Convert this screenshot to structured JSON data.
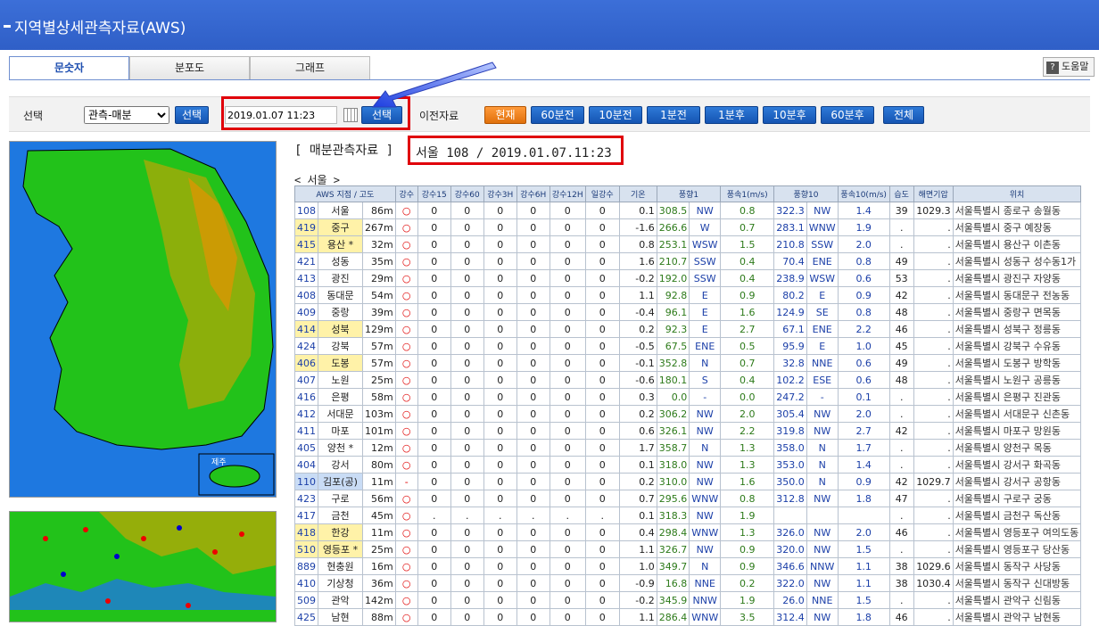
{
  "window": {
    "title": "지역별상세관측자료(AWS)"
  },
  "tabs": [
    {
      "label": "문숫자",
      "active": true
    },
    {
      "label": "분포도",
      "active": false
    },
    {
      "label": "그래프",
      "active": false
    }
  ],
  "help": {
    "label": "도움말"
  },
  "toolbar": {
    "select_label": "선택",
    "mode_value": "관측-매분",
    "select_button": "선택",
    "datetime_value": "2019.01.07 11:23",
    "confirm_button": "선택",
    "prev_label": "이전자료",
    "time_buttons": [
      "현재",
      "60분전",
      "10분전",
      "1분전",
      "1분후",
      "10분후",
      "60분후",
      "전체"
    ]
  },
  "report": {
    "header": "[ 매분관측자료 ]",
    "station_time": "서울 108 / 2019.01.07.11:23",
    "region_label": "< 서울 >"
  },
  "map": {
    "jeju_label": "제주"
  },
  "table": {
    "columns": [
      "AWS 지점 / 고도",
      "강수",
      "강수15",
      "강수60",
      "강수3H",
      "강수6H",
      "강수12H",
      "일강수",
      "기온",
      "풍향1",
      "",
      "풍속1(m/s)",
      "풍향10",
      "",
      "풍속10(m/s)",
      "습도",
      "해면기압",
      "위치"
    ],
    "rows": [
      {
        "id": "108",
        "name": "서울",
        "alt": "86m",
        "rain": "○",
        "r15": "0",
        "r60": "0",
        "r3h": "0",
        "r6h": "0",
        "r12h": "0",
        "day": "0",
        "temp": "0.1",
        "wd1": "308.5",
        "wd1n": "NW",
        "ws1": "0.8",
        "wd10": "322.3",
        "wd10n": "NW",
        "ws10": "1.4",
        "hum": "39",
        "pres": "1029.3",
        "loc": "서울특별시 종로구 송월동",
        "hl": "none"
      },
      {
        "id": "419",
        "name": "중구",
        "alt": "267m",
        "rain": "○",
        "r15": "0",
        "r60": "0",
        "r3h": "0",
        "r6h": "0",
        "r12h": "0",
        "day": "0",
        "temp": "-1.6",
        "wd1": "266.6",
        "wd1n": "W",
        "ws1": "0.7",
        "wd10": "283.1",
        "wd10n": "WNW",
        "ws10": "1.9",
        "hum": ".",
        "pres": ".",
        "loc": "서울특별시 중구 예장동",
        "hl": "yellow"
      },
      {
        "id": "415",
        "name": "용산 *",
        "alt": "32m",
        "rain": "○",
        "r15": "0",
        "r60": "0",
        "r3h": "0",
        "r6h": "0",
        "r12h": "0",
        "day": "0",
        "temp": "0.8",
        "wd1": "253.1",
        "wd1n": "WSW",
        "ws1": "1.5",
        "wd10": "210.8",
        "wd10n": "SSW",
        "ws10": "2.0",
        "hum": ".",
        "pres": ".",
        "loc": "서울특별시 용산구 이촌동",
        "hl": "yellow"
      },
      {
        "id": "421",
        "name": "성동",
        "alt": "35m",
        "rain": "○",
        "r15": "0",
        "r60": "0",
        "r3h": "0",
        "r6h": "0",
        "r12h": "0",
        "day": "0",
        "temp": "1.6",
        "wd1": "210.7",
        "wd1n": "SSW",
        "ws1": "0.4",
        "wd10": "70.4",
        "wd10n": "ENE",
        "ws10": "0.8",
        "hum": "49",
        "pres": ".",
        "loc": "서울특별시 성동구 성수동1가",
        "hl": "none"
      },
      {
        "id": "413",
        "name": "광진",
        "alt": "29m",
        "rain": "○",
        "r15": "0",
        "r60": "0",
        "r3h": "0",
        "r6h": "0",
        "r12h": "0",
        "day": "0",
        "temp": "-0.2",
        "wd1": "192.0",
        "wd1n": "SSW",
        "ws1": "0.4",
        "wd10": "238.9",
        "wd10n": "WSW",
        "ws10": "0.6",
        "hum": "53",
        "pres": ".",
        "loc": "서울특별시 광진구 자양동",
        "hl": "none"
      },
      {
        "id": "408",
        "name": "동대문",
        "alt": "54m",
        "rain": "○",
        "r15": "0",
        "r60": "0",
        "r3h": "0",
        "r6h": "0",
        "r12h": "0",
        "day": "0",
        "temp": "1.1",
        "wd1": "92.8",
        "wd1n": "E",
        "ws1": "0.9",
        "wd10": "80.2",
        "wd10n": "E",
        "ws10": "0.9",
        "hum": "42",
        "pres": ".",
        "loc": "서울특별시 동대문구 전농동",
        "hl": "none"
      },
      {
        "id": "409",
        "name": "중랑",
        "alt": "39m",
        "rain": "○",
        "r15": "0",
        "r60": "0",
        "r3h": "0",
        "r6h": "0",
        "r12h": "0",
        "day": "0",
        "temp": "-0.4",
        "wd1": "96.1",
        "wd1n": "E",
        "ws1": "1.6",
        "wd10": "124.9",
        "wd10n": "SE",
        "ws10": "0.8",
        "hum": "48",
        "pres": ".",
        "loc": "서울특별시 중랑구 면목동",
        "hl": "none"
      },
      {
        "id": "414",
        "name": "성북",
        "alt": "129m",
        "rain": "○",
        "r15": "0",
        "r60": "0",
        "r3h": "0",
        "r6h": "0",
        "r12h": "0",
        "day": "0",
        "temp": "0.2",
        "wd1": "92.3",
        "wd1n": "E",
        "ws1": "2.7",
        "wd10": "67.1",
        "wd10n": "ENE",
        "ws10": "2.2",
        "hum": "46",
        "pres": ".",
        "loc": "서울특별시 성북구 정릉동",
        "hl": "yellow"
      },
      {
        "id": "424",
        "name": "강북",
        "alt": "57m",
        "rain": "○",
        "r15": "0",
        "r60": "0",
        "r3h": "0",
        "r6h": "0",
        "r12h": "0",
        "day": "0",
        "temp": "-0.5",
        "wd1": "67.5",
        "wd1n": "ENE",
        "ws1": "0.5",
        "wd10": "95.9",
        "wd10n": "E",
        "ws10": "1.0",
        "hum": "45",
        "pres": ".",
        "loc": "서울특별시 강북구 수유동",
        "hl": "none"
      },
      {
        "id": "406",
        "name": "도봉",
        "alt": "57m",
        "rain": "○",
        "r15": "0",
        "r60": "0",
        "r3h": "0",
        "r6h": "0",
        "r12h": "0",
        "day": "0",
        "temp": "-0.1",
        "wd1": "352.8",
        "wd1n": "N",
        "ws1": "0.7",
        "wd10": "32.8",
        "wd10n": "NNE",
        "ws10": "0.6",
        "hum": "49",
        "pres": ".",
        "loc": "서울특별시 도봉구 방학동",
        "hl": "yellow"
      },
      {
        "id": "407",
        "name": "노원",
        "alt": "25m",
        "rain": "○",
        "r15": "0",
        "r60": "0",
        "r3h": "0",
        "r6h": "0",
        "r12h": "0",
        "day": "0",
        "temp": "-0.6",
        "wd1": "180.1",
        "wd1n": "S",
        "ws1": "0.4",
        "wd10": "102.2",
        "wd10n": "ESE",
        "ws10": "0.6",
        "hum": "48",
        "pres": ".",
        "loc": "서울특별시 노원구 공릉동",
        "hl": "none"
      },
      {
        "id": "416",
        "name": "은평",
        "alt": "58m",
        "rain": "○",
        "r15": "0",
        "r60": "0",
        "r3h": "0",
        "r6h": "0",
        "r12h": "0",
        "day": "0",
        "temp": "0.3",
        "wd1": "0.0",
        "wd1n": "-",
        "ws1": "0.0",
        "wd10": "247.2",
        "wd10n": "-",
        "ws10": "0.1",
        "hum": ".",
        "pres": ".",
        "loc": "서울특별시 은평구 진관동",
        "hl": "none"
      },
      {
        "id": "412",
        "name": "서대문",
        "alt": "103m",
        "rain": "○",
        "r15": "0",
        "r60": "0",
        "r3h": "0",
        "r6h": "0",
        "r12h": "0",
        "day": "0",
        "temp": "0.2",
        "wd1": "306.2",
        "wd1n": "NW",
        "ws1": "2.0",
        "wd10": "305.4",
        "wd10n": "NW",
        "ws10": "2.0",
        "hum": ".",
        "pres": ".",
        "loc": "서울특별시 서대문구 신촌동",
        "hl": "none"
      },
      {
        "id": "411",
        "name": "마포",
        "alt": "101m",
        "rain": "○",
        "r15": "0",
        "r60": "0",
        "r3h": "0",
        "r6h": "0",
        "r12h": "0",
        "day": "0",
        "temp": "0.6",
        "wd1": "326.1",
        "wd1n": "NW",
        "ws1": "2.2",
        "wd10": "319.8",
        "wd10n": "NW",
        "ws10": "2.7",
        "hum": "42",
        "pres": ".",
        "loc": "서울특별시 마포구 망원동",
        "hl": "none"
      },
      {
        "id": "405",
        "name": "양천 *",
        "alt": "12m",
        "rain": "○",
        "r15": "0",
        "r60": "0",
        "r3h": "0",
        "r6h": "0",
        "r12h": "0",
        "day": "0",
        "temp": "1.7",
        "wd1": "358.7",
        "wd1n": "N",
        "ws1": "1.3",
        "wd10": "358.0",
        "wd10n": "N",
        "ws10": "1.7",
        "hum": ".",
        "pres": ".",
        "loc": "서울특별시 양천구 목동",
        "hl": "none"
      },
      {
        "id": "404",
        "name": "강서",
        "alt": "80m",
        "rain": "○",
        "r15": "0",
        "r60": "0",
        "r3h": "0",
        "r6h": "0",
        "r12h": "0",
        "day": "0",
        "temp": "0.1",
        "wd1": "318.0",
        "wd1n": "NW",
        "ws1": "1.3",
        "wd10": "353.0",
        "wd10n": "N",
        "ws10": "1.4",
        "hum": ".",
        "pres": ".",
        "loc": "서울특별시 강서구 화곡동",
        "hl": "none"
      },
      {
        "id": "110",
        "name": "김포(공)",
        "alt": "11m",
        "rain": "-",
        "r15": "0",
        "r60": "0",
        "r3h": "0",
        "r6h": "0",
        "r12h": "0",
        "day": "0",
        "temp": "0.2",
        "wd1": "310.0",
        "wd1n": "NW",
        "ws1": "1.6",
        "wd10": "350.0",
        "wd10n": "N",
        "ws10": "0.9",
        "hum": "42",
        "pres": "1029.7",
        "loc": "서울특별시 강서구 공항동",
        "hl": "blue"
      },
      {
        "id": "423",
        "name": "구로",
        "alt": "56m",
        "rain": "○",
        "r15": "0",
        "r60": "0",
        "r3h": "0",
        "r6h": "0",
        "r12h": "0",
        "day": "0",
        "temp": "0.7",
        "wd1": "295.6",
        "wd1n": "WNW",
        "ws1": "0.8",
        "wd10": "312.8",
        "wd10n": "NW",
        "ws10": "1.8",
        "hum": "47",
        "pres": ".",
        "loc": "서울특별시 구로구 궁동",
        "hl": "none"
      },
      {
        "id": "417",
        "name": "금천",
        "alt": "45m",
        "rain": "○",
        "r15": ".",
        "r60": ".",
        "r3h": ".",
        "r6h": ".",
        "r12h": ".",
        "day": ".",
        "temp": "0.1",
        "wd1": "318.3",
        "wd1n": "NW",
        "ws1": "1.9",
        "wd10": "",
        "wd10n": "",
        "ws10": "",
        "hum": ".",
        "pres": ".",
        "loc": "서울특별시 금천구 독산동",
        "hl": "none"
      },
      {
        "id": "418",
        "name": "한강",
        "alt": "11m",
        "rain": "○",
        "r15": "0",
        "r60": "0",
        "r3h": "0",
        "r6h": "0",
        "r12h": "0",
        "day": "0",
        "temp": "0.4",
        "wd1": "298.4",
        "wd1n": "WNW",
        "ws1": "1.3",
        "wd10": "326.0",
        "wd10n": "NW",
        "ws10": "2.0",
        "hum": "46",
        "pres": ".",
        "loc": "서울특별시 영등포구 여의도동",
        "hl": "yellow"
      },
      {
        "id": "510",
        "name": "영등포 *",
        "alt": "25m",
        "rain": "○",
        "r15": "0",
        "r60": "0",
        "r3h": "0",
        "r6h": "0",
        "r12h": "0",
        "day": "0",
        "temp": "1.1",
        "wd1": "326.7",
        "wd1n": "NW",
        "ws1": "0.9",
        "wd10": "320.0",
        "wd10n": "NW",
        "ws10": "1.5",
        "hum": ".",
        "pres": ".",
        "loc": "서울특별시 영등포구 당산동",
        "hl": "yellow"
      },
      {
        "id": "889",
        "name": "현충원",
        "alt": "16m",
        "rain": "○",
        "r15": "0",
        "r60": "0",
        "r3h": "0",
        "r6h": "0",
        "r12h": "0",
        "day": "0",
        "temp": "1.0",
        "wd1": "349.7",
        "wd1n": "N",
        "ws1": "0.9",
        "wd10": "346.6",
        "wd10n": "NNW",
        "ws10": "1.1",
        "hum": "38",
        "pres": "1029.6",
        "loc": "서울특별시 동작구 사당동",
        "hl": "none"
      },
      {
        "id": "410",
        "name": "기상청",
        "alt": "36m",
        "rain": "○",
        "r15": "0",
        "r60": "0",
        "r3h": "0",
        "r6h": "0",
        "r12h": "0",
        "day": "0",
        "temp": "-0.9",
        "wd1": "16.8",
        "wd1n": "NNE",
        "ws1": "0.2",
        "wd10": "322.0",
        "wd10n": "NW",
        "ws10": "1.1",
        "hum": "38",
        "pres": "1030.4",
        "loc": "서울특별시 동작구 신대방동",
        "hl": "none"
      },
      {
        "id": "509",
        "name": "관악",
        "alt": "142m",
        "rain": "○",
        "r15": "0",
        "r60": "0",
        "r3h": "0",
        "r6h": "0",
        "r12h": "0",
        "day": "0",
        "temp": "-0.2",
        "wd1": "345.9",
        "wd1n": "NNW",
        "ws1": "1.9",
        "wd10": "26.0",
        "wd10n": "NNE",
        "ws10": "1.5",
        "hum": ".",
        "pres": ".",
        "loc": "서울특별시 관악구 신림동",
        "hl": "none"
      },
      {
        "id": "425",
        "name": "남현",
        "alt": "88m",
        "rain": "○",
        "r15": "0",
        "r60": "0",
        "r3h": "0",
        "r6h": "0",
        "r12h": "0",
        "day": "0",
        "temp": "1.1",
        "wd1": "286.4",
        "wd1n": "WNW",
        "ws1": "3.5",
        "wd10": "312.4",
        "wd10n": "NW",
        "ws10": "1.8",
        "hum": "46",
        "pres": ".",
        "loc": "서울특별시 관악구 남현동",
        "hl": "none"
      }
    ]
  }
}
